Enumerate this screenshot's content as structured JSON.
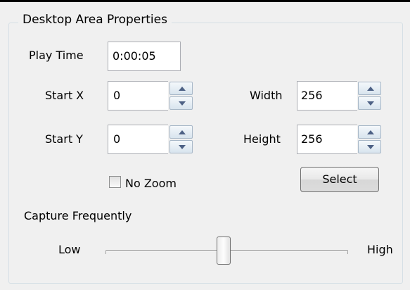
{
  "group": {
    "title": "Desktop Area Properties",
    "play_time": {
      "label": "Play Time",
      "value": "0:00:05"
    },
    "start_x": {
      "label": "Start X",
      "value": "0"
    },
    "start_y": {
      "label": "Start Y",
      "value": "0"
    },
    "width": {
      "label": "Width",
      "value": "256"
    },
    "height": {
      "label": "Height",
      "value": "256"
    },
    "no_zoom": {
      "label": "No Zoom",
      "checked": false
    },
    "select_button": "Select"
  },
  "capture": {
    "label": "Capture Frequently",
    "low_label": "Low",
    "high_label": "High",
    "level_percent": 50
  },
  "icons": {
    "spin_up": "triangle-up-icon",
    "spin_down": "triangle-down-icon"
  }
}
